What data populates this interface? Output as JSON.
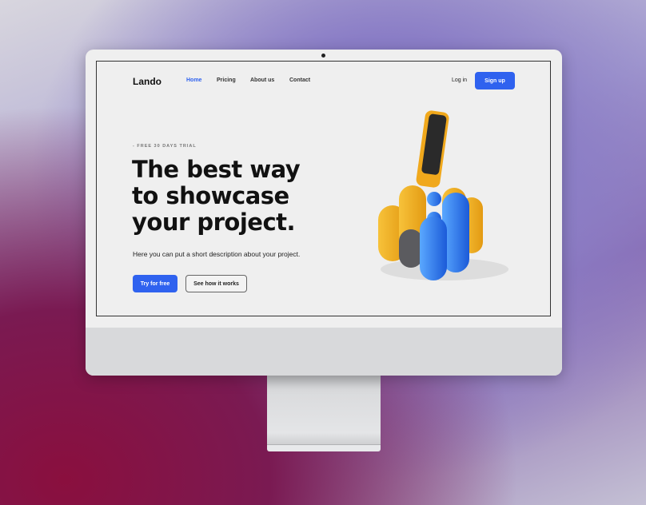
{
  "nav": {
    "logo": "Lando",
    "links": [
      "Home",
      "Pricing",
      "About us",
      "Contact"
    ],
    "login": "Log in",
    "signup": "Sign up",
    "accent": "#2f62ef"
  },
  "hero": {
    "eyebrow": "- FREE 30 DAYS TRIAL",
    "title": "The best way to showcase your project.",
    "description": "Here you can put a short description about your project.",
    "primary": "Try for free",
    "secondary": "See how it works"
  }
}
